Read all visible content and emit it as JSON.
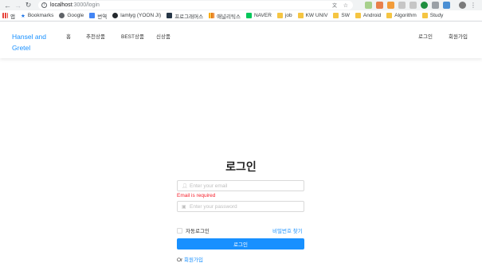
{
  "browser": {
    "url_host": "localhost",
    "url_path": ":3000/login",
    "back_icon": "arrow-left",
    "forward_icon": "arrow-right",
    "reload_icon": "reload"
  },
  "bookmarks": [
    {
      "label": "앱",
      "icon": "apps-grid"
    },
    {
      "label": "Bookmarks",
      "icon": "star"
    },
    {
      "label": "Google",
      "icon": "globe"
    },
    {
      "label": "번역",
      "icon": "translate"
    },
    {
      "label": "lamlyg (YOON JI)",
      "icon": "github"
    },
    {
      "label": "프로그래머스",
      "icon": "programmers"
    },
    {
      "label": "애널리틱스",
      "icon": "analytics"
    },
    {
      "label": "NAVER",
      "icon": "naver"
    },
    {
      "label": "job",
      "icon": "folder"
    },
    {
      "label": "KW UNIV",
      "icon": "folder"
    },
    {
      "label": "SW",
      "icon": "folder"
    },
    {
      "label": "Android",
      "icon": "folder"
    },
    {
      "label": "Algorithm",
      "icon": "folder"
    },
    {
      "label": "Study",
      "icon": "folder"
    }
  ],
  "header": {
    "brand_line1": "Hansel and",
    "brand_line2": "Gretel",
    "nav": [
      "홈",
      "추천상품",
      "BEST상품",
      "신상품"
    ],
    "login": "로그인",
    "signup": "회원가입"
  },
  "form": {
    "title": "로그인",
    "email_placeholder": "Enter your email",
    "email_error": "Email is required",
    "password_placeholder": "Enter your password",
    "remember_label": "자동로그인",
    "forgot_label": "비밀번호 찾기",
    "submit_label": "로그인",
    "or_text": "Or ",
    "signup_link": "회원가입"
  },
  "colors": {
    "accent": "#1890ff",
    "error": "#f5222d"
  }
}
